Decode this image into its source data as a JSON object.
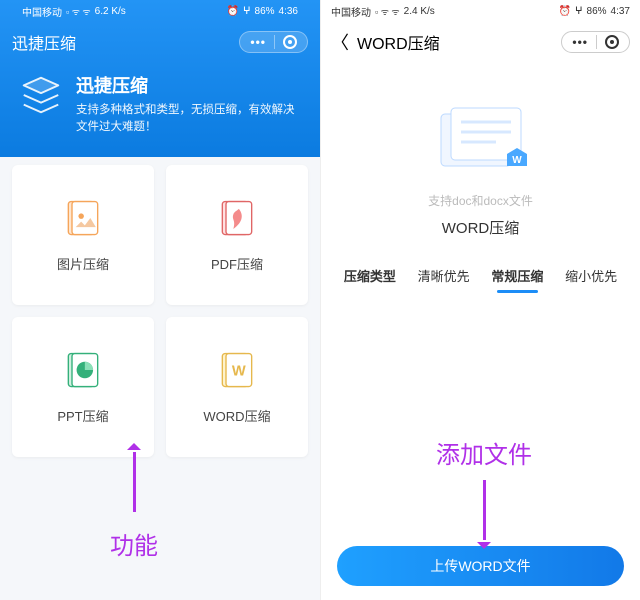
{
  "left": {
    "status": {
      "carrier": "中国移动",
      "net": "4G",
      "speed": "6.2 K/s",
      "battery": "86%",
      "time": "4:36"
    },
    "app_title": "迅捷压缩",
    "banner": {
      "title": "迅捷压缩",
      "sub": "支持多种格式和类型，无损压缩，有效解决文件过大难题！"
    },
    "tiles": [
      {
        "label": "图片压缩"
      },
      {
        "label": "PDF压缩"
      },
      {
        "label": "PPT压缩"
      },
      {
        "label": "WORD压缩"
      }
    ],
    "annotation": "功能"
  },
  "right": {
    "status": {
      "carrier": "中国移动",
      "net": "4G",
      "speed": "2.4 K/s",
      "battery": "86%",
      "time": "4:37"
    },
    "title": "WORD压缩",
    "illust_sub": "支持doc和docx文件",
    "illust_title": "WORD压缩",
    "tabs": {
      "type_label": "压缩类型",
      "items": [
        "清晰优先",
        "常规压缩",
        "缩小优先"
      ],
      "active_index": 1
    },
    "upload_button": "上传WORD文件",
    "annotation": "添加文件"
  }
}
